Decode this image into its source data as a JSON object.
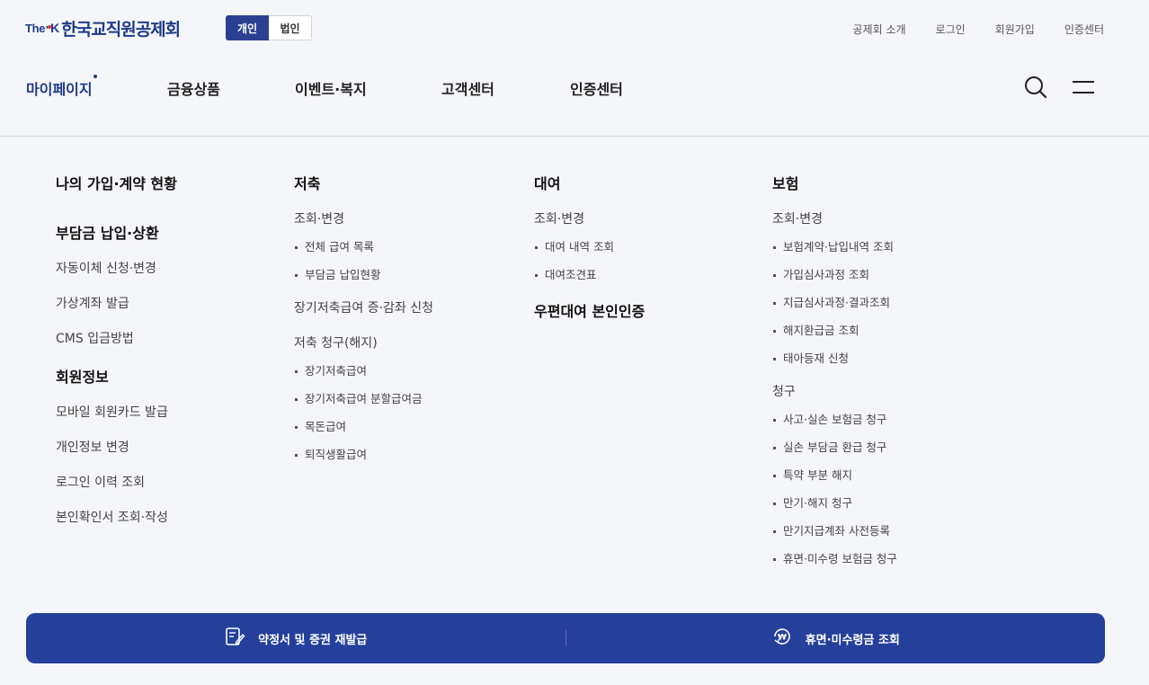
{
  "brand": {
    "the": "The",
    "k": "K",
    "name": "한국교직원공제회"
  },
  "member_toggle": {
    "individual": "개인",
    "corporate": "법인",
    "selected": "개인"
  },
  "utility_links": [
    "공제회 소개",
    "로그인",
    "회원가입",
    "인증센터"
  ],
  "gnb": {
    "items": [
      "마이페이지",
      "금융상품",
      "이벤트·복지",
      "고객센터",
      "인증센터"
    ],
    "current": "마이페이지",
    "search_icon": "search-icon",
    "menu_icon": "hamburger-menu-icon"
  },
  "col1": {
    "title1": "나의 가입·계약 현황",
    "title2": "부담금 납입·상환",
    "links2": [
      "자동이체 신청·변경",
      "가상계좌 발급",
      "CMS 입금방법"
    ],
    "title3": "회원정보",
    "links3": [
      "모바일 회원카드 발급",
      "개인정보 변경",
      "로그인 이력 조회",
      "본인확인서 조회·작성"
    ]
  },
  "col2": {
    "title": "저축",
    "group1": {
      "label": "조회·변경",
      "items": [
        "전체 급여 목록",
        "부담금 납입현황"
      ]
    },
    "link2": "장기저축급여 증·감좌 신청",
    "group3": {
      "label": "저축 청구(해지)",
      "items": [
        "장기저축급여",
        "장기저축급여 분할급여금",
        "목돈급여",
        "퇴직생활급여"
      ]
    }
  },
  "col3": {
    "title": "대여",
    "group1": {
      "label": "조회·변경",
      "items": [
        "대여 내역 조회",
        "대여조견표"
      ]
    },
    "title2": "우편대여 본인인증"
  },
  "col4": {
    "title": "보험",
    "group1": {
      "label": "조회·변경",
      "items": [
        "보험계약·납입내역 조회",
        "가입심사과정 조회",
        "지급심사과정·결과조회",
        "해지환급금 조회",
        "태아등재 신청"
      ]
    },
    "group2": {
      "label": "청구",
      "items": [
        "사고·실손 보험금 청구",
        "실손 부담금 환급 청구",
        "특약 부분 해지",
        "만기·해지 청구",
        "만기지급계좌 사전등록",
        "휴면·미수령 보험금 청구"
      ]
    }
  },
  "bottom_bar": {
    "left": "약정서 및 증권 재발급",
    "right": "휴면·미수령금 조회",
    "colors": {
      "bar": "#24409b"
    }
  }
}
